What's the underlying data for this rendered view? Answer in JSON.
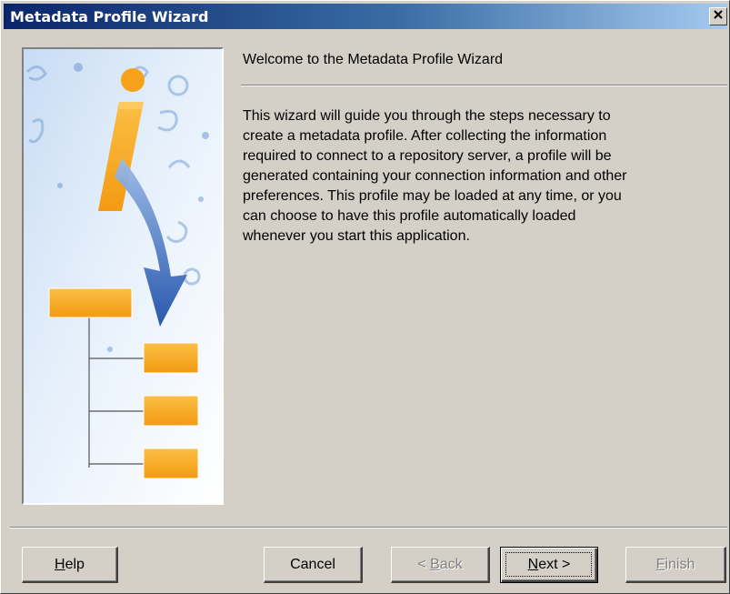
{
  "window": {
    "title": "Metadata Profile Wizard",
    "close_label": "×"
  },
  "page": {
    "heading": "Welcome to the Metadata Profile Wizard",
    "body_lines": [
      "This wizard will guide you through the steps necessary to",
      "create a metadata profile.  After collecting the information",
      "required to connect to a repository server, a profile will be",
      "generated containing your connection information and other",
      "preferences. This profile may be loaded at any time, or you",
      "can choose to have this profile automatically loaded",
      "whenever you start this application."
    ]
  },
  "buttons": {
    "help": {
      "pre": "",
      "mnemonic": "H",
      "post": "elp",
      "enabled": true
    },
    "cancel": {
      "pre": "",
      "mnemonic": "",
      "post": "Cancel",
      "enabled": true
    },
    "back": {
      "pre": "< ",
      "mnemonic": "B",
      "post": "ack",
      "enabled": false
    },
    "next": {
      "pre": "",
      "mnemonic": "N",
      "post": "ext >",
      "enabled": true,
      "default": true
    },
    "finish": {
      "pre": "",
      "mnemonic": "F",
      "post": "inish",
      "enabled": false
    }
  },
  "colors": {
    "window_face": "#d4d0c8",
    "titlebar_start": "#0a246a",
    "titlebar_end": "#a6caf0",
    "orange_accent": "#f7a21b",
    "arrow_blue": "#1f4fa8"
  },
  "graphic": {
    "icon": "info-i-icon"
  }
}
